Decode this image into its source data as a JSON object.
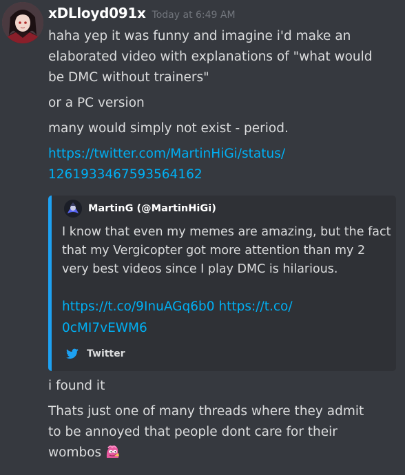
{
  "message": {
    "username": "xDLloyd091x",
    "timestamp": "Today at 6:49 AM",
    "avatar_icon": "anime-avatar",
    "paragraphs": [
      [
        "haha yep it was funny and imagine i'd make an",
        "elaborated video with explanations of \"what would",
        "be DMC without trainers\""
      ],
      [
        "or a PC version"
      ],
      [
        "many would simply not exist - period."
      ]
    ],
    "link_lines": [
      "https://twitter.com/MartinHiGi/status/",
      "1261933467593564162"
    ],
    "after_paragraphs": [
      [
        "i found it"
      ],
      [
        "Thats just one of many threads where they admit",
        "to be annoyed that people dont care for their"
      ]
    ],
    "last_line": "wombos",
    "emoji_icon": "pink-pepe-emoji"
  },
  "embed": {
    "accent_color": "#1da1f2",
    "author": "MartinG (@MartinHiGi)",
    "author_icon": "twitter-user-avatar",
    "description_lines": [
      "I know that even my memes are amazing, but the fact",
      "that my Vergicopter got more attention than my 2",
      "very best videos since I play DMC is hilarious."
    ],
    "link_lines": [
      "https://t.co/9InuAGq6b0 https://t.co/",
      "0cMI7vEWM6"
    ],
    "footer_icon": "twitter-bird-icon",
    "footer_text": "Twitter"
  },
  "colors": {
    "background": "#36393f",
    "embed_background": "#2f3136",
    "link": "#00b0f4",
    "text": "#dcddde",
    "muted": "#72767d"
  }
}
